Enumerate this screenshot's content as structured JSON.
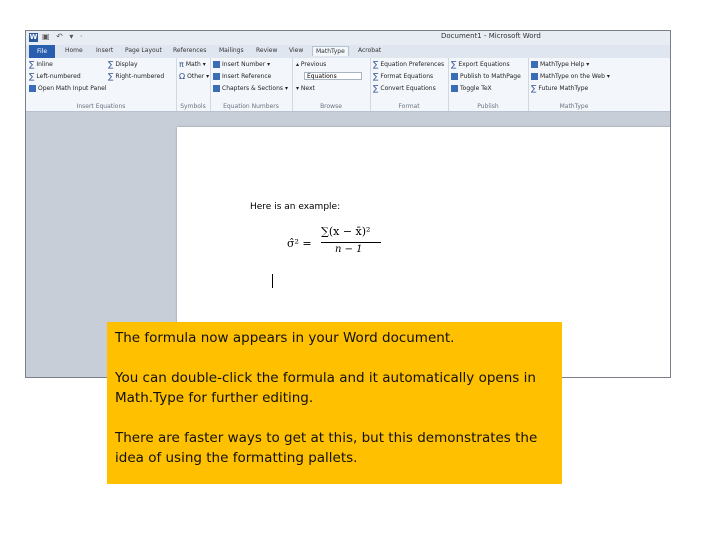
{
  "window": {
    "title": "Document1 - Microsoft Word",
    "app_icon": "W",
    "qat": "▣ ↶ ▾ ·"
  },
  "tabs": [
    "File",
    "Home",
    "Insert",
    "Page Layout",
    "References",
    "Mailings",
    "Review",
    "View",
    "MathType",
    "Acrobat"
  ],
  "active_tab": "MathType",
  "ribbon": {
    "insert_equations": {
      "label": "Insert Equations",
      "items": [
        "Inline",
        "Display",
        "Left-numbered",
        "Right-numbered",
        "Open Math Input Panel"
      ]
    },
    "symbols": {
      "label": "Symbols",
      "items": [
        "Math",
        "Other"
      ]
    },
    "equation_numbers": {
      "label": "Equation Numbers",
      "items": [
        "Insert Number",
        "Insert Reference",
        "Chapters & Sections"
      ]
    },
    "browse": {
      "label": "Browse",
      "items": [
        "Previous",
        "Equations",
        "Next"
      ]
    },
    "format": {
      "label": "Format",
      "items": [
        "Equation Preferences",
        "Format Equations",
        "Convert Equations"
      ]
    },
    "publish": {
      "label": "Publish",
      "items": [
        "Export Equations",
        "Publish to MathPage",
        "Toggle TeX"
      ]
    },
    "mathtype": {
      "label": "MathType",
      "items": [
        "MathType Help",
        "MathType on the Web",
        "Future MathType"
      ]
    }
  },
  "document": {
    "example_text": "Here is an example:",
    "formula": {
      "lhs": "σ̂² =",
      "numerator": "∑(x − x̄)²",
      "denominator": "n − 1"
    }
  },
  "note": {
    "paragraphs": [
      "The formula now appears in your Word document.",
      "You can double-click the formula and it automatically opens in Math.Type for further editing.",
      "There are faster ways to get at this, but this demonstrates the idea of using the formatting pallets."
    ],
    "background": "#ffc000"
  }
}
